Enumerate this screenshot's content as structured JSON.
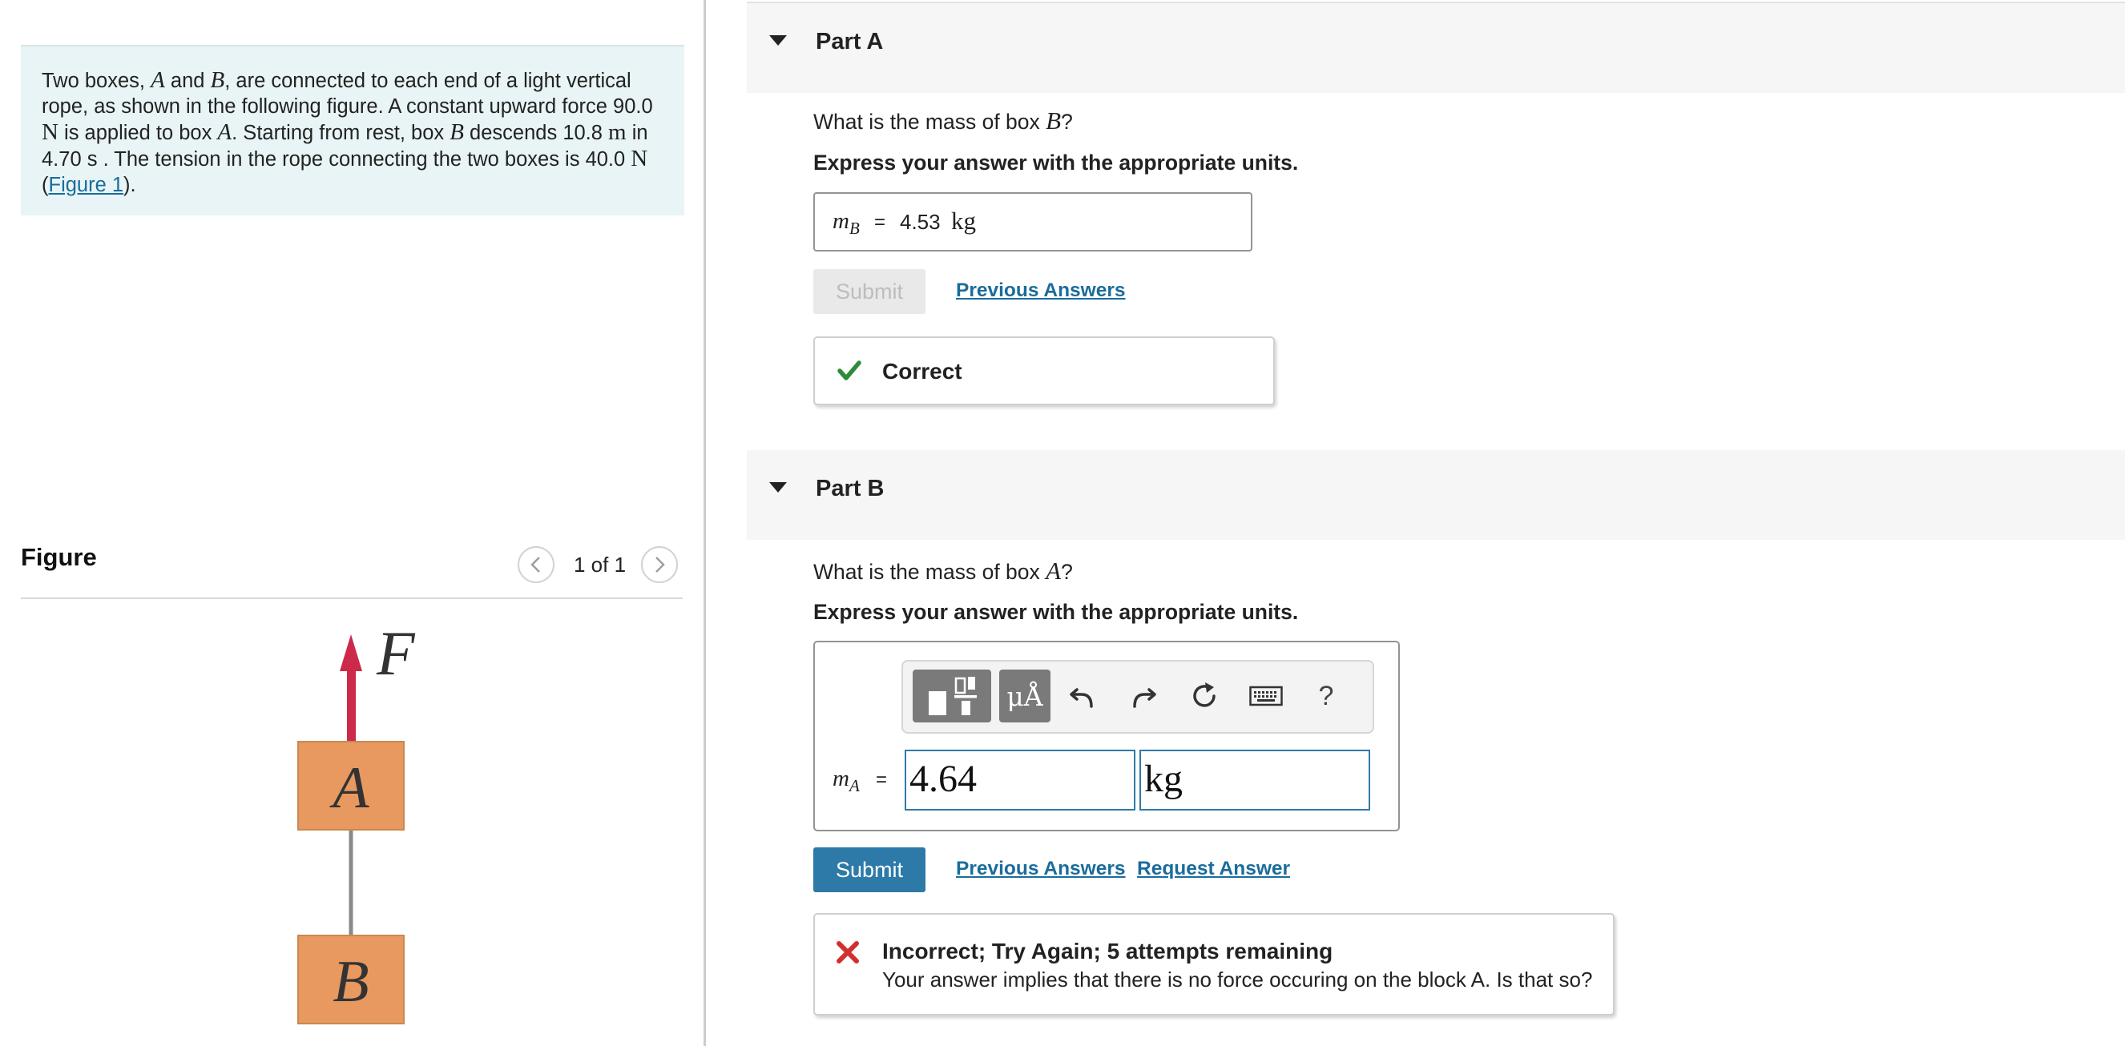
{
  "problem": {
    "seg1": "Two boxes, ",
    "varA": "A",
    "seg2": " and ",
    "varB": "B",
    "seg3": ", are connected to each end of a light vertical rope, as shown in the following figure. A constant upward force ",
    "force_value": "90.0",
    "unit_N": "N",
    "seg4": " is applied to box ",
    "seg5": ". Starting from rest, box ",
    "seg6": " descends ",
    "distance_value": "10.8",
    "unit_m": "m",
    "seg7": " in ",
    "time_value": "4.70",
    "unit_s": "s",
    "seg8": " . The tension in the rope connecting the two boxes is ",
    "tension_value": "40.0",
    "seg9": " (",
    "figure_link": "Figure 1",
    "seg10": ")."
  },
  "figure": {
    "title": "Figure",
    "counter": "1 of 1",
    "force_label": "F",
    "box_top_label": "A",
    "box_bottom_label": "B",
    "colors": {
      "box": "#e8995f",
      "arrow": "#cc2a4a",
      "rope": "#8a8a8a"
    }
  },
  "partA": {
    "title": "Part A",
    "question_pre": "What is the mass of box ",
    "question_var": "B",
    "question_post": "?",
    "instruction": "Express your answer with the appropriate units.",
    "var_main": "m",
    "var_sub": "B",
    "equals": "=",
    "answer_value": "4.53",
    "answer_unit": "kg",
    "submit_label": "Submit",
    "previous_answers": "Previous Answers",
    "feedback": "Correct"
  },
  "partB": {
    "title": "Part B",
    "question_pre": "What is the mass of box ",
    "question_var": "A",
    "question_post": "?",
    "instruction": "Express your answer with the appropriate units.",
    "toolbar": {
      "units_symbol": "μÅ",
      "help_symbol": "?"
    },
    "var_main": "m",
    "var_sub": "A",
    "equals": "=",
    "value_input": "4.64",
    "unit_input": "kg",
    "submit_label": "Submit",
    "previous_answers": "Previous Answers",
    "request_answer": "Request Answer",
    "feedback_title": "Incorrect; Try Again; 5 attempts remaining",
    "feedback_detail": "Your answer implies that there is no force occuring on the block A. Is that so?"
  },
  "colors": {
    "accent": "#2d7aa8",
    "link": "#1a6c9c",
    "correct": "#2e8b3a",
    "incorrect": "#d32f2f",
    "problem_bg": "#e8f4f5"
  }
}
